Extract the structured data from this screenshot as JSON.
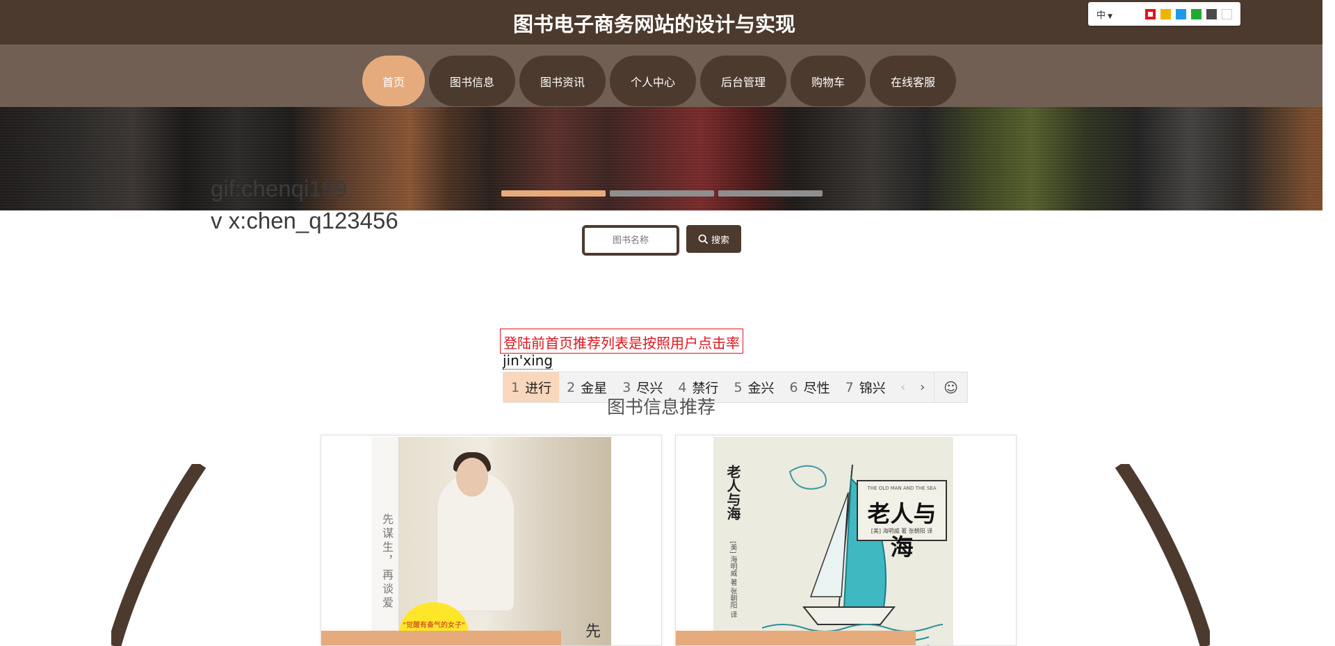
{
  "header": {
    "title": "图书电子商务网站的设计与实现",
    "language": "中",
    "theme_colors": [
      "#e0141e",
      "#f0b400",
      "#1f9ae8",
      "#1faa33",
      "#4b4b4b",
      "#ffffff"
    ]
  },
  "nav": {
    "items": [
      {
        "label": "首页",
        "active": true
      },
      {
        "label": "图书信息"
      },
      {
        "label": "图书资讯"
      },
      {
        "label": "个人中心"
      },
      {
        "label": "后台管理"
      },
      {
        "label": "购物车"
      },
      {
        "label": "在线客服"
      }
    ]
  },
  "overlay": {
    "line1": "gif:chenqi199",
    "line2": "v x:chen_q123456"
  },
  "search": {
    "placeholder": "图书名称",
    "button_label": "搜索"
  },
  "ime": {
    "note": "登陆前首页推荐列表是按照用户点击率",
    "composition": "jin'xing",
    "candidates": [
      {
        "num": "1",
        "text": "进行"
      },
      {
        "num": "2",
        "text": "金星"
      },
      {
        "num": "3",
        "text": "尽兴"
      },
      {
        "num": "4",
        "text": "禁行"
      },
      {
        "num": "5",
        "text": "金兴"
      },
      {
        "num": "6",
        "text": "尽性"
      },
      {
        "num": "7",
        "text": "锦兴"
      }
    ]
  },
  "section": {
    "title": "图书信息推荐"
  },
  "books": [
    {
      "spine": "先谋生，再谈爱",
      "badge": "\"觉醒有奋气的女子\" 系列作品",
      "cover_text": "先"
    },
    {
      "title": "老人与海",
      "title_en": "THE OLD MAN AND THE SEA",
      "subtitle": "[美] 海明威 著  张朝阳 译"
    }
  ],
  "colors": {
    "primary": "#4d3a2e",
    "accent": "#e6ab7d",
    "nav_bg": "#715f54"
  }
}
